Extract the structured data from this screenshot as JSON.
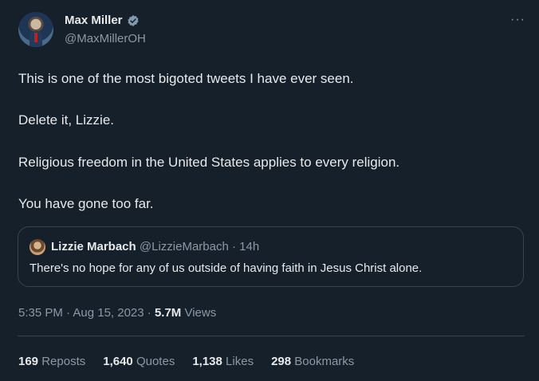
{
  "author": {
    "name": "Max Miller",
    "handle": "@MaxMillerOH"
  },
  "more_label": "···",
  "tweet": {
    "lines": [
      "This is one of the most bigoted tweets I have ever seen.",
      "Delete it, Lizzie.",
      "Religious freedom in the United States applies to every religion.",
      "You have gone too far."
    ]
  },
  "quote": {
    "name": "Lizzie Marbach",
    "handle_time": "@LizzieMarbach · 14h",
    "text": "There's no hope for any of us outside of having faith in Jesus Christ alone."
  },
  "meta": {
    "time_date": "5:35 PM · Aug 15, 2023 · ",
    "views_count": "5.7M",
    "views_label": " Views"
  },
  "stats": {
    "reposts_count": "169",
    "reposts_label": "Reposts",
    "quotes_count": "1,640",
    "quotes_label": "Quotes",
    "likes_count": "1,138",
    "likes_label": "Likes",
    "bookmarks_count": "298",
    "bookmarks_label": "Bookmarks"
  },
  "colors": {
    "background": "#15202b",
    "text": "#e7e9ea",
    "secondary": "#8b98a5",
    "border": "#38444d"
  }
}
